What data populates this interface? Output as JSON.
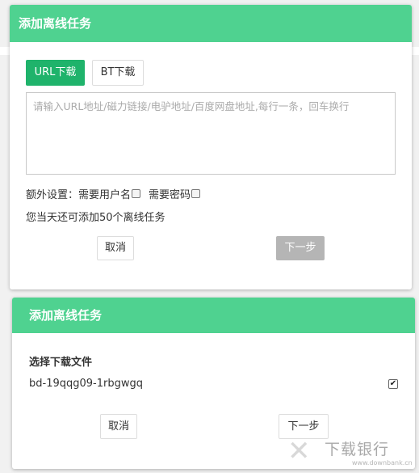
{
  "colors": {
    "accent": "#4fd290",
    "tab_active": "#1fb36b",
    "btn_disabled": "#b5b5b5"
  },
  "dialog1": {
    "title": "添加离线任务",
    "tabs": [
      {
        "label": "URL下载",
        "active": true
      },
      {
        "label": "BT下载",
        "active": false
      }
    ],
    "textarea_placeholder": "请输入URL地址/磁力链接/电驴地址/百度网盘地址,每行一条，回车换行",
    "extra_label": "额外设置：",
    "option_username": {
      "label": "需要用户名",
      "checked": false
    },
    "option_password": {
      "label": "需要密码",
      "checked": false
    },
    "info_text": "您当天还可添加50个离线任务",
    "cancel_label": "取消",
    "next_label": "下一步",
    "next_disabled": true
  },
  "dialog2": {
    "title": "添加离线任务",
    "section_title": "选择下载文件",
    "file": {
      "name": "bd-19qqg09-1rbgwgq",
      "checked": true
    },
    "cancel_label": "取消",
    "next_label": "下一步"
  },
  "watermark": {
    "name": "下载银行",
    "url": "www.downbank.cn",
    "logo_icon": "xz-logo-icon"
  }
}
